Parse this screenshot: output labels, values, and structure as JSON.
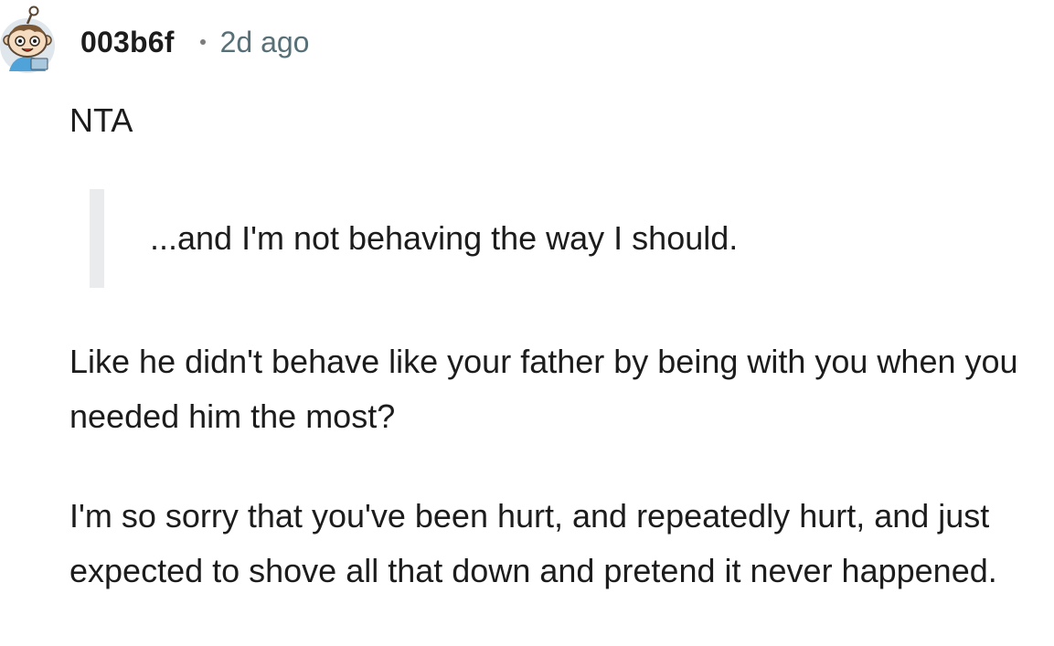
{
  "comment": {
    "avatar_icon": "snoo-avatar-icon",
    "author": "003b6f",
    "timestamp": "2d ago",
    "paragraphs": {
      "nta": "NTA",
      "quote": "...and I'm not behaving the way I should.",
      "second": "Like he didn't behave like your father by being with you when you needed him the most?",
      "third": "I'm so sorry that you've been hurt, and repeatedly hurt, and just expected to shove all that down and pretend it never happened."
    }
  },
  "colors": {
    "text": "#1c1c1c",
    "meta": "#576f76",
    "quote_bar": "#e9ebed",
    "background": "#ffffff"
  }
}
